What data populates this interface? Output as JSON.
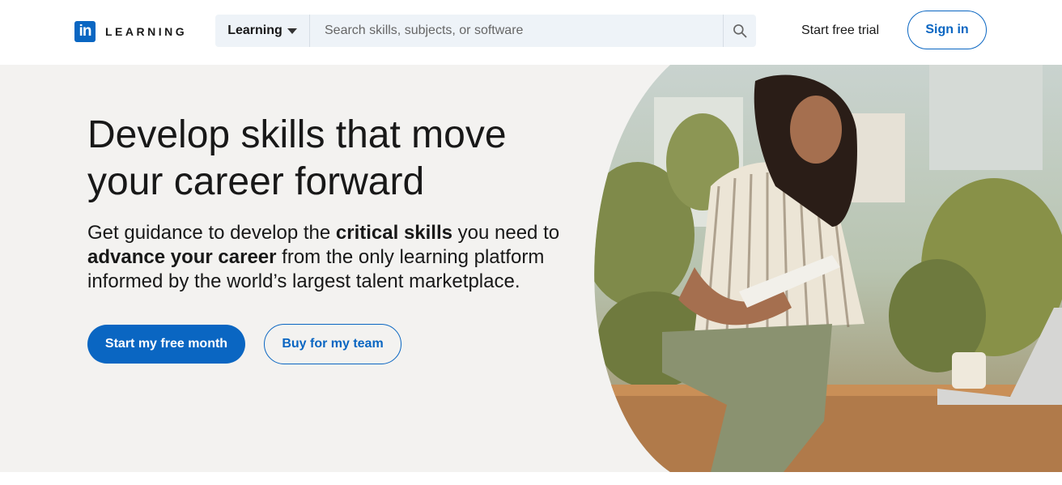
{
  "header": {
    "logo_mark": "in",
    "logo_word": "LEARNING",
    "search": {
      "category": "Learning",
      "placeholder": "Search skills, subjects, or software"
    },
    "start_trial": "Start free trial",
    "sign_in": "Sign in"
  },
  "hero": {
    "headline": "Develop skills that move your career forward",
    "subline_parts": {
      "p1": "Get guidance to develop the ",
      "b1": "critical skills",
      "p2": " you need to ",
      "b2": "advance your career",
      "p3": " from the only learning platform informed by the world’s largest talent marketplace."
    },
    "primary_cta": "Start my free month",
    "secondary_cta": "Buy for my team"
  },
  "colors": {
    "brand": "#0a66c2",
    "hero_bg": "#f3f2f0",
    "search_bg": "#eef3f8"
  }
}
